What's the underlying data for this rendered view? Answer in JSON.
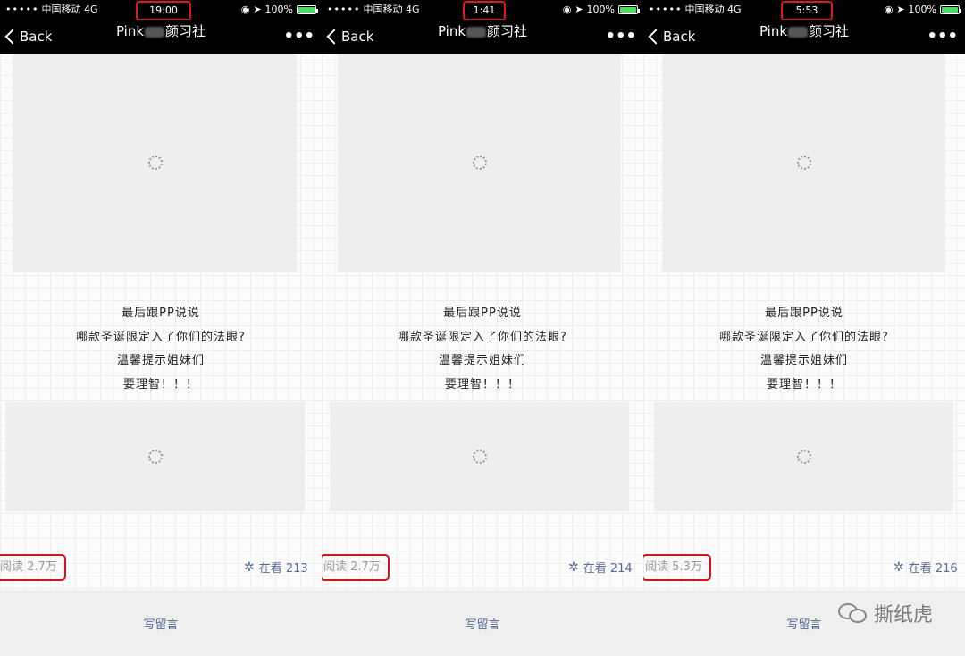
{
  "panels": [
    {
      "carrier": "中国移动",
      "network": "4G",
      "time": "19:00",
      "battery": "100%",
      "back_label": "Back",
      "title_prefix": "Pink",
      "title_suffix": "颜习社",
      "lines": [
        "最后跟PP说说",
        "哪款圣诞限定入了你们的法眼?",
        "温馨提示姐妹们",
        "要理智！！！"
      ],
      "read_label": "阅读 2.7万",
      "looking_label": "在看 213",
      "comment_label": "写留言"
    },
    {
      "carrier": "中国移动",
      "network": "4G",
      "time": "1:41",
      "battery": "100%",
      "back_label": "Back",
      "title_prefix": "Pink",
      "title_suffix": "颜习社",
      "lines": [
        "最后跟PP说说",
        "哪款圣诞限定入了你们的法眼?",
        "温馨提示姐妹们",
        "要理智！！！"
      ],
      "read_label": "阅读 2.7万",
      "looking_label": "在看 214",
      "comment_label": "写留言"
    },
    {
      "carrier": "中国移动",
      "network": "4G",
      "time": "5:53",
      "battery": "100%",
      "back_label": "Back",
      "title_prefix": "Pink",
      "title_suffix": "颜习社",
      "lines": [
        "最后跟PP说说",
        "哪款圣诞限定入了你们的法眼?",
        "温馨提示姐妹们",
        "要理智！！！"
      ],
      "read_label": "阅读 5.3万",
      "looking_label": "在看 216",
      "comment_label": "写留言"
    }
  ],
  "watermark": "撕纸虎",
  "colors": {
    "highlight": "#e0191e",
    "link": "#576b95",
    "battery": "#4cd964"
  }
}
